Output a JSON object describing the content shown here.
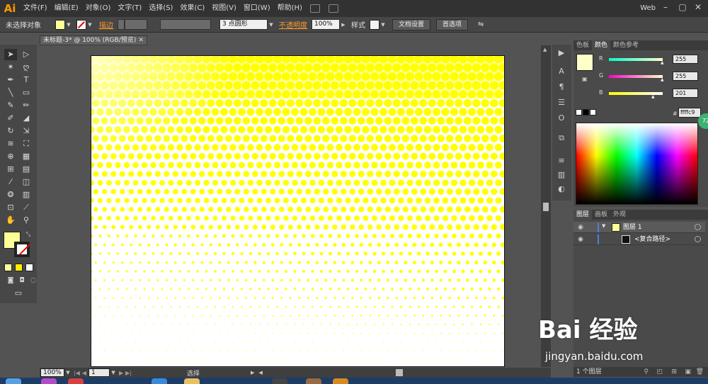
{
  "app": {
    "logo": "Ai"
  },
  "menu": [
    "文件(F)",
    "编辑(E)",
    "对象(O)",
    "文字(T)",
    "选择(S)",
    "效果(C)",
    "视图(V)",
    "窗口(W)",
    "帮助(H)"
  ],
  "workspace": "Web",
  "window_controls": {
    "minimize": "–",
    "maximize": "▢",
    "close": "✕"
  },
  "controlbar": {
    "selection_status": "未选择对象",
    "stroke_label": "描边",
    "brush_value": "3 点圆形",
    "opacity_label": "不透明度",
    "opacity_value": "100%",
    "style_label": "样式",
    "doc_settings_button": "文档设置",
    "preferences_button": "首选项"
  },
  "document": {
    "tab_title": "未标题-3* @ 100% (RGB/预览)",
    "close": "✕"
  },
  "statusbar": {
    "zoom": "100%",
    "artboard": "1",
    "tool": "选择"
  },
  "color_panel": {
    "tabs": [
      "色板",
      "颜色",
      "颜色参考"
    ],
    "active_tab": 1,
    "r_label": "R",
    "r_value": "255",
    "g_label": "G",
    "g_value": "255",
    "b_label": "B",
    "b_value": "201",
    "hex_label": "#",
    "hex_value": "ffffc9"
  },
  "badge": "72",
  "layers_panel": {
    "tabs": [
      "图层",
      "画板",
      "外观"
    ],
    "active_tab": 0,
    "layers": [
      {
        "name": "图层 1"
      },
      {
        "name": "<复合路径>"
      }
    ],
    "footer": "1 个图层"
  },
  "watermark": {
    "logo": "Bai 经验",
    "url": "jingyan.baidu.com"
  },
  "colors": {
    "fill": "#ffff99",
    "halftone": "#ffff00",
    "accent_orange": "#ff9a2a",
    "layer_highlight": "#4f7fd9"
  }
}
